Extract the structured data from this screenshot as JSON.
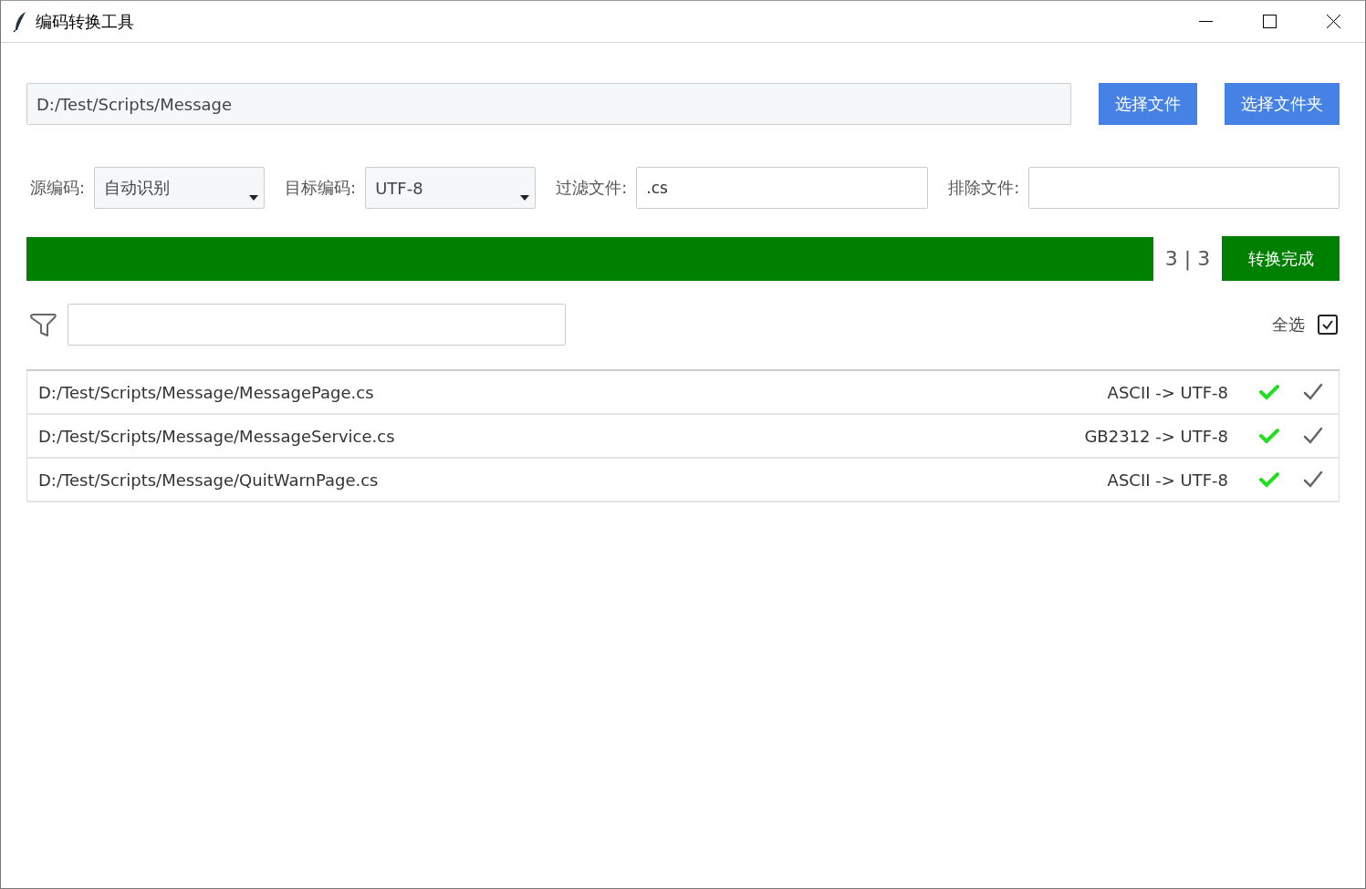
{
  "window": {
    "title": "编码转换工具"
  },
  "path_field": {
    "value": "D:/Test/Scripts/Message"
  },
  "buttons": [
    {
      "label": "选择文件"
    },
    {
      "label": "选择文件夹"
    }
  ],
  "options": [
    {
      "kind": "dropdown",
      "label": "源编码:",
      "value": "自动识别"
    },
    {
      "kind": "dropdown",
      "label": "目标编码:",
      "value": "UTF-8"
    },
    {
      "kind": "text",
      "label": "过滤文件:",
      "value": ".cs"
    },
    {
      "kind": "text",
      "label": "排除文件:"
    }
  ],
  "progress": {
    "level": 1.0,
    "count": "3 | 3",
    "status_button": "转换完成"
  },
  "filter": {
    "select_all_label": "全选",
    "select_all_checked": true
  },
  "files": [
    {
      "path": "D:/Test/Scripts/Message/MessagePage.cs",
      "conversion": "ASCII -> UTF-8",
      "converted": true,
      "checked": true
    },
    {
      "path": "D:/Test/Scripts/Message/MessageService.cs",
      "conversion": "GB2312 -> UTF-8",
      "converted": true,
      "checked": true
    },
    {
      "path": "D:/Test/Scripts/Message/QuitWarnPage.cs",
      "conversion": "ASCII -> UTF-8",
      "converted": true,
      "checked": true
    }
  ]
}
